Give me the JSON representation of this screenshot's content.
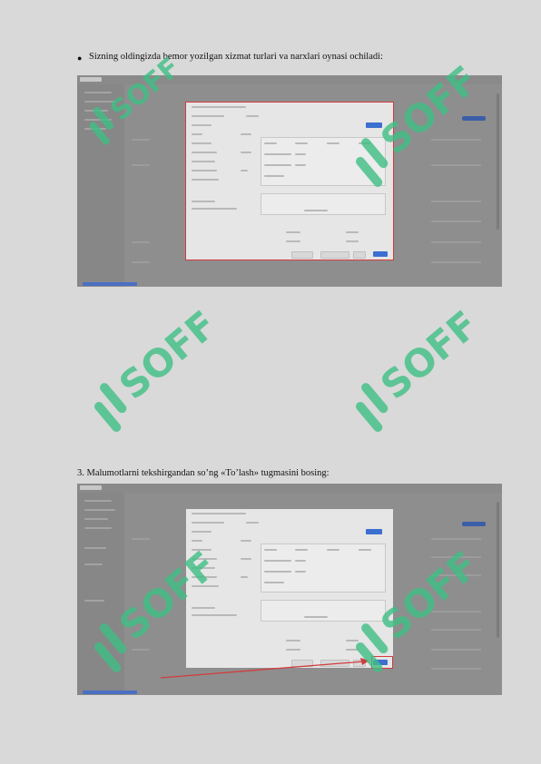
{
  "instructions": {
    "bullet_text": "Sizning oldingizda bemor yozilgan xizmat turlari va narxlari oynasi ochiladi:",
    "step3_text": "3. Malumotlarni tekshirgandan so’ng «To’lash» tugmasini bosing:"
  },
  "watermark": {
    "text": "SOFF",
    "color": "#2ea66f"
  },
  "screenshots": [
    {
      "modal_outline": "#d23c3c",
      "primary_button_color": "#3d6fd0"
    },
    {
      "highlight_color": "#d23c3c",
      "primary_button_color": "#3d6fd0"
    }
  ]
}
